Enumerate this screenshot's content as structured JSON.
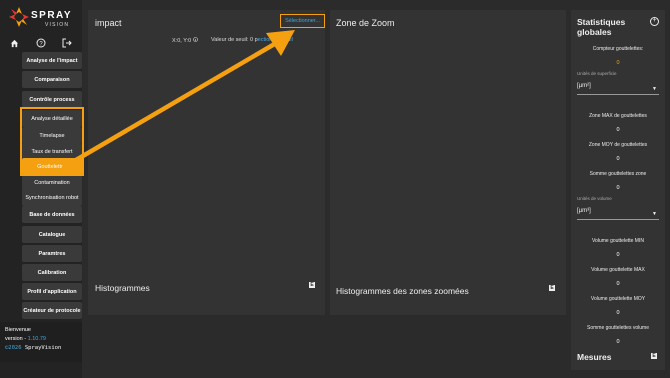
{
  "logo": {
    "line1": "SPRAY",
    "line2": "VISION"
  },
  "sidebar": {
    "items": [
      {
        "label": "Analyse de l'impact"
      },
      {
        "label": "Comparaison"
      },
      {
        "label": "Contrôle process"
      },
      {
        "label": "Analyse détaillée"
      },
      {
        "label": "Timelapse"
      },
      {
        "label": "Taux de transfert"
      },
      {
        "label": "Gouttelettes"
      },
      {
        "label": "Contamination"
      },
      {
        "label": "Synchronisation robot"
      },
      {
        "label": "Base de données"
      },
      {
        "label": "Catalogue"
      },
      {
        "label": "Paramtres"
      },
      {
        "label": "Calibration"
      },
      {
        "label": "Profil d'application"
      },
      {
        "label": "Créateur de protocole"
      }
    ]
  },
  "welcome": {
    "greeting": "Bienvenue",
    "version_label": "version - ",
    "version_value": "1.10.79",
    "copyright_symbol": "©2026",
    "copyright_name": " SprayVision"
  },
  "impact": {
    "title": "impact",
    "select_button": "Sélectionner...",
    "coords": "X:0, Y:0",
    "seuil_label": "Valeur de seuil: 0 p",
    "seuil_link": "ection du seuil",
    "histogram_title": "Histogrammes",
    "export_glyph": "E"
  },
  "zoom": {
    "title": "Zone de Zoom",
    "histogram_title": "Histogrammes des zones zoomées",
    "export_glyph": "E"
  },
  "stats": {
    "title_line1": "Statistiques",
    "title_line2": "globales",
    "add_glyph": "+",
    "compteur_label": "Compteur gouttelettes:",
    "compteur_value": "0",
    "surface_unit_label": "Unités de superficie",
    "surface_unit_value": "[µm²]",
    "zone_max_label": "Zone MAX de gouttelettes",
    "zone_max_value": "0",
    "zone_moy_label": "Zone MOY de gouttelettes",
    "zone_moy_value": "0",
    "somme_zone_label": "Somme gouttelettes zone",
    "somme_zone_value": "0",
    "volume_unit_label": "Unités de volume",
    "volume_unit_value": "[µm³]",
    "vol_min_label": "Volume gouttelette MIN",
    "vol_min_value": "0",
    "vol_max_label": "Volume gouttelette MAX",
    "vol_max_value": "0",
    "vol_moy_label": "Volume gouttelette MOY",
    "vol_moy_value": "0",
    "somme_vol_label": "Somme gouttelettes volume",
    "somme_vol_value": "0",
    "mesures_title": "Mesures",
    "export_glyph": "E"
  },
  "colors": {
    "accent": "#f5a010",
    "link": "#40a9e0",
    "panel": "#333333",
    "background": "#2b2b2b"
  }
}
